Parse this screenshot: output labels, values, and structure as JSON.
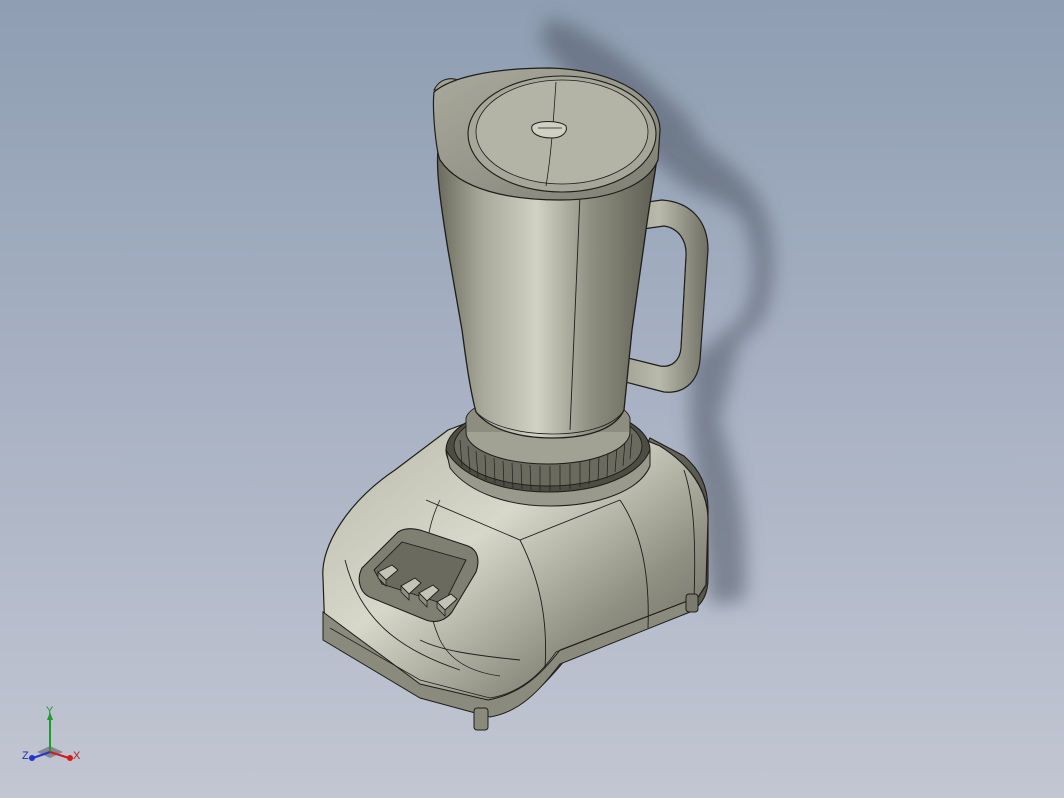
{
  "viewport": {
    "background_top": "#8f9eb3",
    "background_bottom": "#c2c6d2"
  },
  "model": {
    "body_color": "#8e8e80",
    "edge_color": "#1e1e1a",
    "shadow_color": "#4f5866"
  },
  "triad": {
    "x_label": "X",
    "y_label": "Y",
    "z_label": "Z",
    "x_color": "#d21c1c",
    "y_color": "#1f9d2a",
    "z_color": "#2533c8"
  }
}
